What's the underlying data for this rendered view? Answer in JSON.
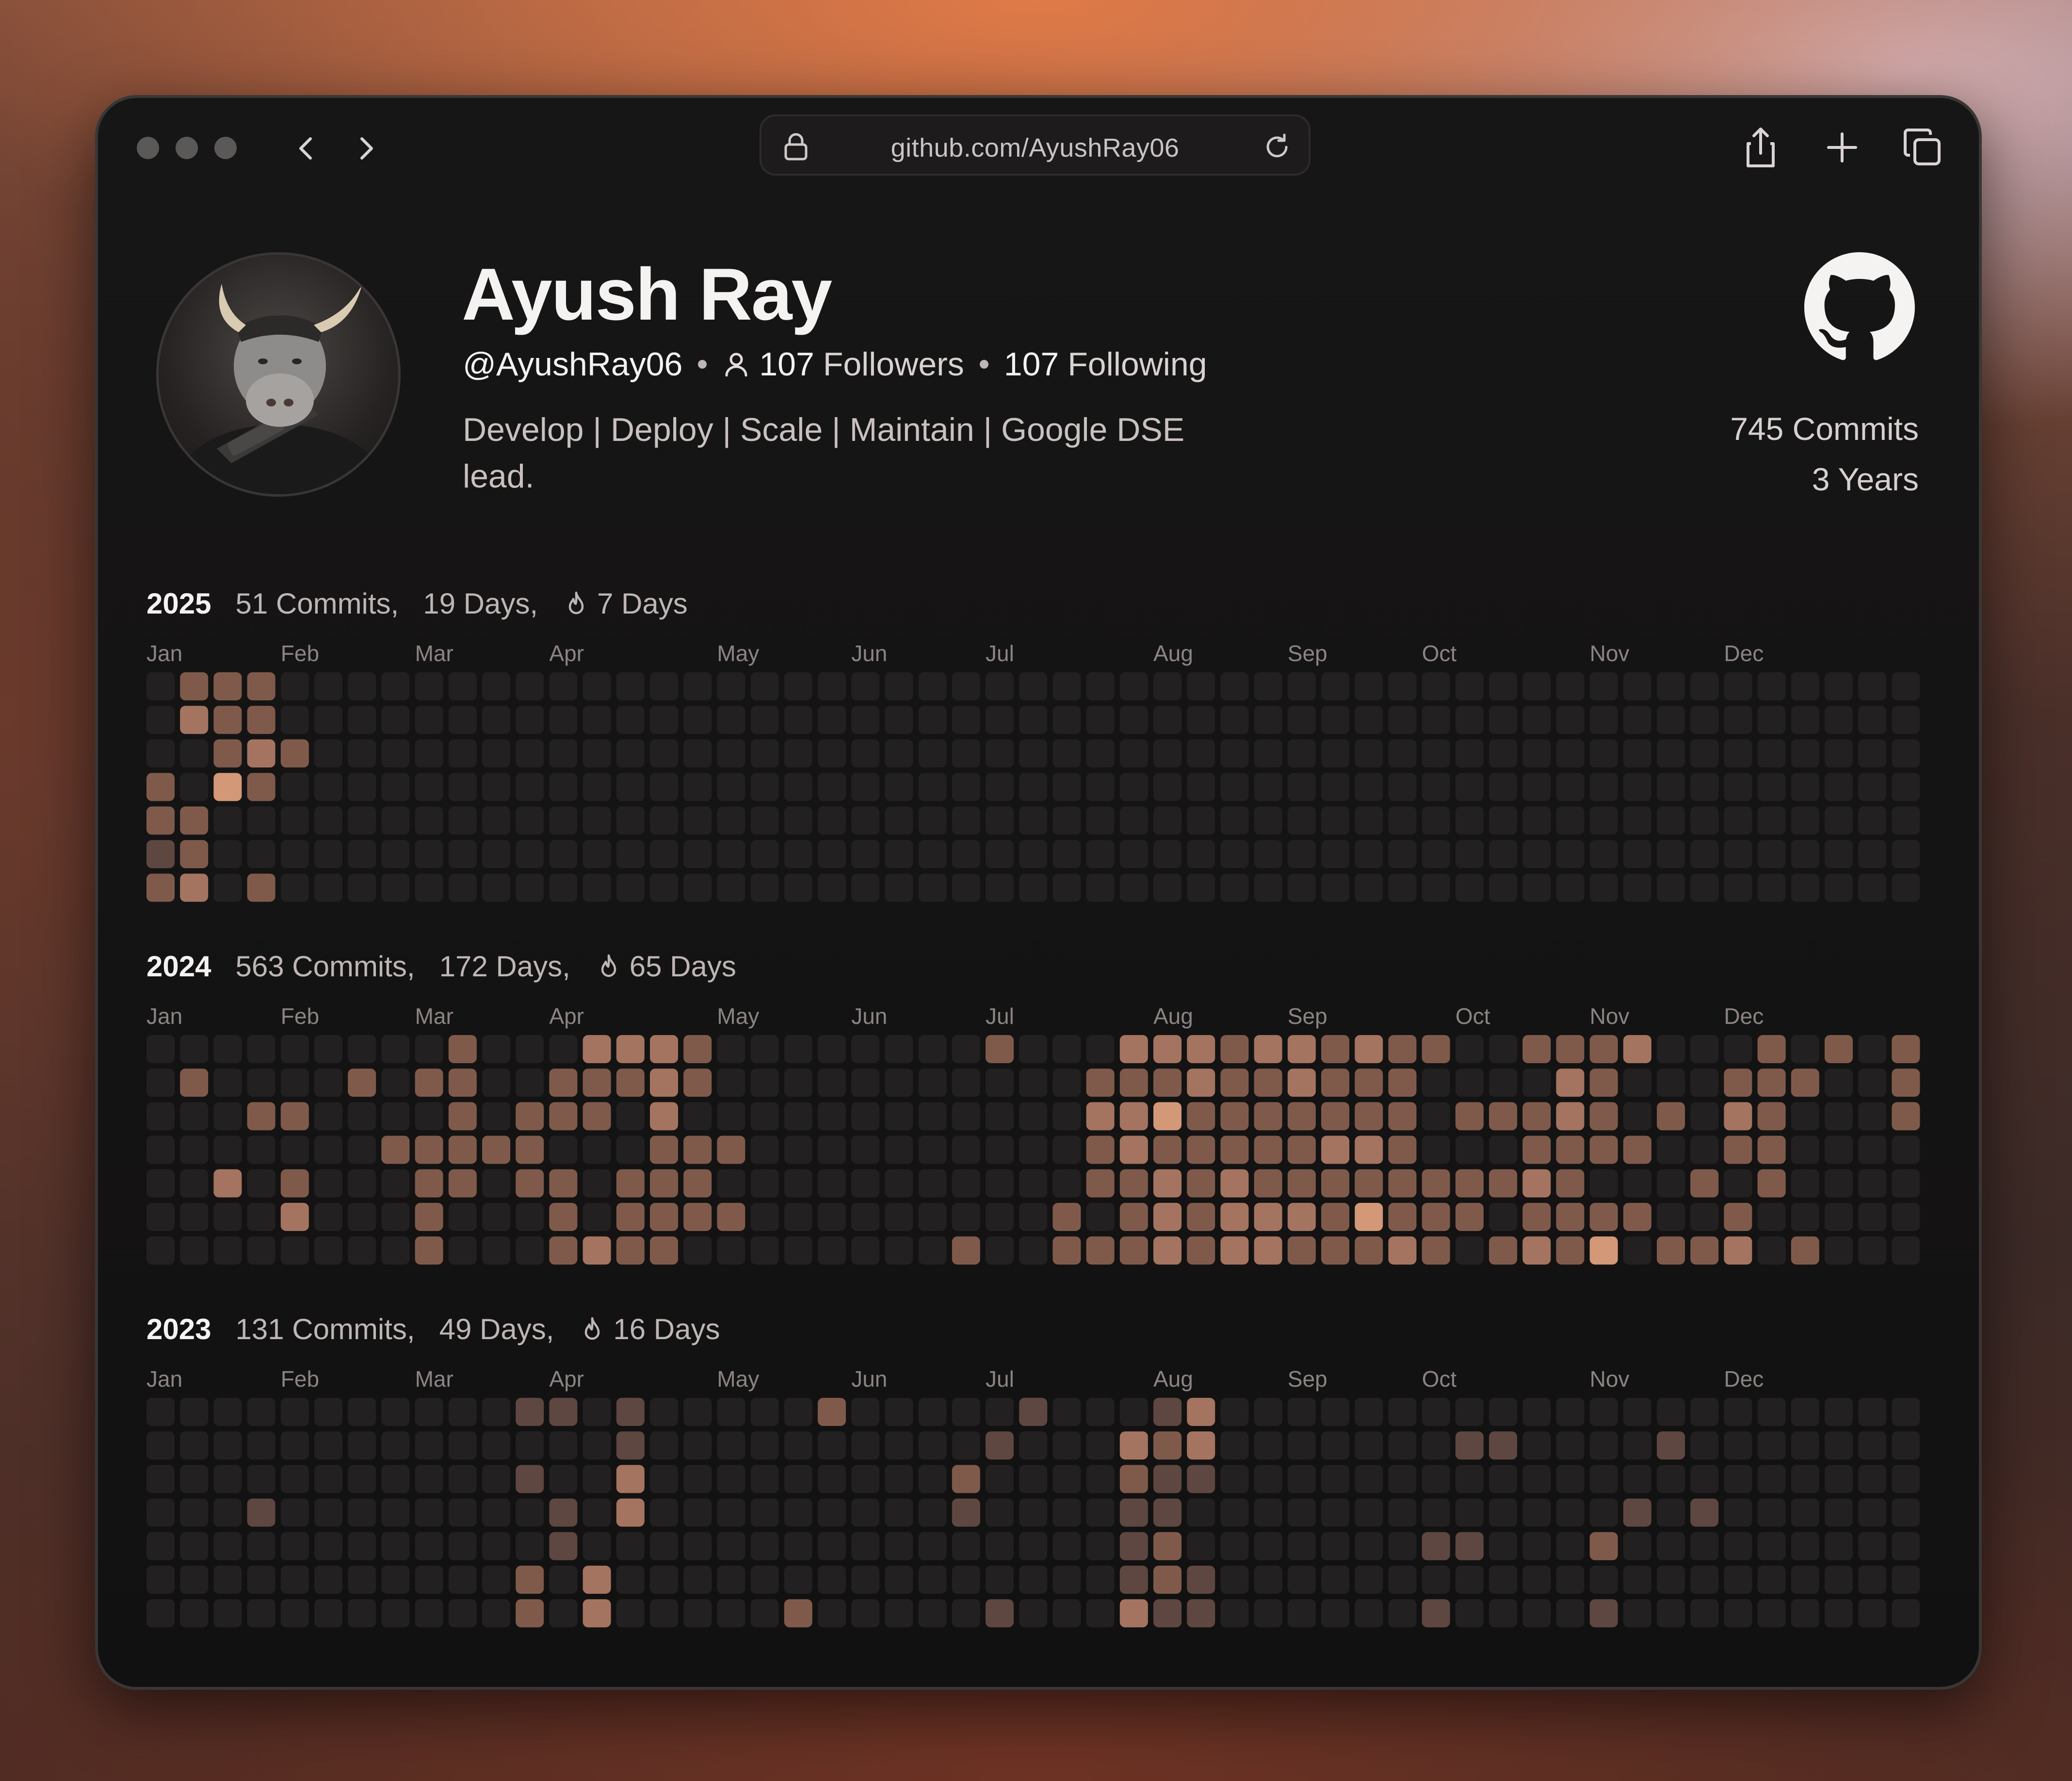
{
  "browser": {
    "url": "github.com/AyushRay06",
    "window_dots": [
      "close",
      "minimize",
      "zoom"
    ],
    "icons": [
      "chevron-left-icon",
      "chevron-right-icon",
      "lock-icon",
      "reload-icon",
      "share-icon",
      "plus-icon",
      "tabs-icon"
    ]
  },
  "profile": {
    "name": "Ayush Ray",
    "handle": "@AyushRay06",
    "followers_count": "107",
    "followers_label": "Followers",
    "following_count": "107",
    "following_label": "Following",
    "bio_line1": "Develop | Deploy | Scale | Maintain | Google DSE",
    "bio_line2": "lead.",
    "total_commits": "745 Commits",
    "total_years": "3 Years"
  },
  "colors": {
    "empty": "#222020",
    "level1": "#5e4740",
    "level2": "#7f5a4b",
    "level3": "#a47460",
    "level4": "#d39877"
  },
  "months": [
    "Jan",
    "Feb",
    "Mar",
    "Apr",
    "May",
    "Jun",
    "Jul",
    "Aug",
    "Sep",
    "Oct",
    "Nov",
    "Dec"
  ],
  "years": [
    {
      "year": "2025",
      "commits": "51 Commits,",
      "days": "19 Days,",
      "streak": "7 Days",
      "month_weeks": [
        0,
        4,
        8,
        12,
        17,
        21,
        25,
        30,
        34,
        38,
        43,
        47
      ],
      "active": [
        [
          1,
          0,
          2
        ],
        [
          2,
          0,
          2
        ],
        [
          3,
          0,
          2
        ],
        [
          1,
          1,
          3
        ],
        [
          2,
          1,
          2
        ],
        [
          3,
          1,
          2
        ],
        [
          2,
          2,
          2
        ],
        [
          3,
          2,
          3
        ],
        [
          4,
          2,
          2
        ],
        [
          0,
          3,
          2
        ],
        [
          2,
          3,
          4
        ],
        [
          3,
          3,
          2
        ],
        [
          0,
          4,
          2
        ],
        [
          1,
          4,
          2
        ],
        [
          0,
          5,
          1
        ],
        [
          1,
          5,
          2
        ],
        [
          0,
          6,
          2
        ],
        [
          1,
          6,
          3
        ],
        [
          3,
          6,
          2
        ]
      ]
    },
    {
      "year": "2024",
      "commits": "563 Commits,",
      "days": "172 Days,",
      "streak": "65 Days",
      "month_weeks": [
        0,
        4,
        8,
        12,
        17,
        21,
        25,
        30,
        34,
        39,
        43,
        47
      ],
      "active": [
        [
          9,
          0,
          2
        ],
        [
          13,
          0,
          3
        ],
        [
          14,
          0,
          3
        ],
        [
          15,
          0,
          3
        ],
        [
          16,
          0,
          2
        ],
        [
          25,
          0,
          2
        ],
        [
          29,
          0,
          3
        ],
        [
          30,
          0,
          3
        ],
        [
          31,
          0,
          3
        ],
        [
          32,
          0,
          2
        ],
        [
          33,
          0,
          3
        ],
        [
          34,
          0,
          3
        ],
        [
          35,
          0,
          2
        ],
        [
          36,
          0,
          3
        ],
        [
          37,
          0,
          2
        ],
        [
          38,
          0,
          2
        ],
        [
          41,
          0,
          2
        ],
        [
          42,
          0,
          2
        ],
        [
          43,
          0,
          2
        ],
        [
          44,
          0,
          3
        ],
        [
          48,
          0,
          2
        ],
        [
          50,
          0,
          2
        ],
        [
          52,
          0,
          2
        ],
        [
          1,
          1,
          2
        ],
        [
          6,
          1,
          2
        ],
        [
          8,
          1,
          2
        ],
        [
          9,
          1,
          2
        ],
        [
          12,
          1,
          2
        ],
        [
          13,
          1,
          2
        ],
        [
          14,
          1,
          2
        ],
        [
          15,
          1,
          3
        ],
        [
          16,
          1,
          2
        ],
        [
          28,
          1,
          2
        ],
        [
          29,
          1,
          2
        ],
        [
          30,
          1,
          2
        ],
        [
          31,
          1,
          3
        ],
        [
          32,
          1,
          2
        ],
        [
          33,
          1,
          2
        ],
        [
          34,
          1,
          3
        ],
        [
          35,
          1,
          2
        ],
        [
          36,
          1,
          2
        ],
        [
          37,
          1,
          2
        ],
        [
          42,
          1,
          3
        ],
        [
          43,
          1,
          2
        ],
        [
          47,
          1,
          2
        ],
        [
          48,
          1,
          2
        ],
        [
          49,
          1,
          2
        ],
        [
          52,
          1,
          2
        ],
        [
          3,
          2,
          2
        ],
        [
          4,
          2,
          2
        ],
        [
          9,
          2,
          2
        ],
        [
          11,
          2,
          2
        ],
        [
          12,
          2,
          2
        ],
        [
          13,
          2,
          2
        ],
        [
          15,
          2,
          3
        ],
        [
          28,
          2,
          3
        ],
        [
          29,
          2,
          3
        ],
        [
          30,
          2,
          4
        ],
        [
          31,
          2,
          2
        ],
        [
          32,
          2,
          2
        ],
        [
          33,
          2,
          2
        ],
        [
          34,
          2,
          2
        ],
        [
          35,
          2,
          2
        ],
        [
          36,
          2,
          2
        ],
        [
          37,
          2,
          2
        ],
        [
          39,
          2,
          2
        ],
        [
          40,
          2,
          2
        ],
        [
          41,
          2,
          2
        ],
        [
          42,
          2,
          3
        ],
        [
          43,
          2,
          2
        ],
        [
          45,
          2,
          2
        ],
        [
          47,
          2,
          3
        ],
        [
          48,
          2,
          2
        ],
        [
          52,
          2,
          2
        ],
        [
          7,
          3,
          2
        ],
        [
          8,
          3,
          2
        ],
        [
          9,
          3,
          2
        ],
        [
          10,
          3,
          2
        ],
        [
          11,
          3,
          2
        ],
        [
          15,
          3,
          2
        ],
        [
          16,
          3,
          2
        ],
        [
          17,
          3,
          2
        ],
        [
          28,
          3,
          2
        ],
        [
          29,
          3,
          3
        ],
        [
          30,
          3,
          2
        ],
        [
          31,
          3,
          2
        ],
        [
          32,
          3,
          2
        ],
        [
          33,
          3,
          2
        ],
        [
          34,
          3,
          2
        ],
        [
          35,
          3,
          3
        ],
        [
          36,
          3,
          3
        ],
        [
          37,
          3,
          2
        ],
        [
          41,
          3,
          2
        ],
        [
          42,
          3,
          2
        ],
        [
          43,
          3,
          2
        ],
        [
          44,
          3,
          2
        ],
        [
          47,
          3,
          2
        ],
        [
          48,
          3,
          2
        ],
        [
          2,
          4,
          3
        ],
        [
          4,
          4,
          2
        ],
        [
          8,
          4,
          2
        ],
        [
          9,
          4,
          2
        ],
        [
          11,
          4,
          2
        ],
        [
          12,
          4,
          2
        ],
        [
          14,
          4,
          2
        ],
        [
          15,
          4,
          2
        ],
        [
          16,
          4,
          2
        ],
        [
          28,
          4,
          2
        ],
        [
          29,
          4,
          2
        ],
        [
          30,
          4,
          3
        ],
        [
          31,
          4,
          2
        ],
        [
          32,
          4,
          3
        ],
        [
          33,
          4,
          2
        ],
        [
          34,
          4,
          2
        ],
        [
          35,
          4,
          2
        ],
        [
          36,
          4,
          2
        ],
        [
          37,
          4,
          2
        ],
        [
          38,
          4,
          2
        ],
        [
          39,
          4,
          2
        ],
        [
          40,
          4,
          2
        ],
        [
          41,
          4,
          3
        ],
        [
          42,
          4,
          2
        ],
        [
          46,
          4,
          2
        ],
        [
          48,
          4,
          2
        ],
        [
          4,
          5,
          3
        ],
        [
          8,
          5,
          2
        ],
        [
          12,
          5,
          2
        ],
        [
          14,
          5,
          2
        ],
        [
          15,
          5,
          2
        ],
        [
          16,
          5,
          2
        ],
        [
          17,
          5,
          2
        ],
        [
          27,
          5,
          2
        ],
        [
          29,
          5,
          2
        ],
        [
          30,
          5,
          3
        ],
        [
          31,
          5,
          2
        ],
        [
          32,
          5,
          3
        ],
        [
          33,
          5,
          3
        ],
        [
          34,
          5,
          3
        ],
        [
          35,
          5,
          2
        ],
        [
          36,
          5,
          4
        ],
        [
          37,
          5,
          2
        ],
        [
          38,
          5,
          2
        ],
        [
          39,
          5,
          2
        ],
        [
          41,
          5,
          2
        ],
        [
          42,
          5,
          2
        ],
        [
          43,
          5,
          2
        ],
        [
          44,
          5,
          2
        ],
        [
          47,
          5,
          2
        ],
        [
          8,
          6,
          2
        ],
        [
          12,
          6,
          2
        ],
        [
          13,
          6,
          3
        ],
        [
          14,
          6,
          2
        ],
        [
          15,
          6,
          2
        ],
        [
          24,
          6,
          2
        ],
        [
          27,
          6,
          2
        ],
        [
          28,
          6,
          2
        ],
        [
          29,
          6,
          2
        ],
        [
          30,
          6,
          3
        ],
        [
          31,
          6,
          2
        ],
        [
          32,
          6,
          3
        ],
        [
          33,
          6,
          3
        ],
        [
          34,
          6,
          2
        ],
        [
          35,
          6,
          2
        ],
        [
          36,
          6,
          2
        ],
        [
          37,
          6,
          3
        ],
        [
          38,
          6,
          2
        ],
        [
          40,
          6,
          2
        ],
        [
          41,
          6,
          3
        ],
        [
          42,
          6,
          2
        ],
        [
          43,
          6,
          4
        ],
        [
          45,
          6,
          2
        ],
        [
          46,
          6,
          2
        ],
        [
          47,
          6,
          3
        ],
        [
          49,
          6,
          2
        ]
      ]
    },
    {
      "year": "2023",
      "commits": "131 Commits,",
      "days": "49 Days,",
      "streak": "16 Days",
      "month_weeks": [
        0,
        4,
        8,
        12,
        17,
        21,
        25,
        30,
        34,
        38,
        43,
        47
      ],
      "active": [
        [
          11,
          0,
          1
        ],
        [
          12,
          0,
          1
        ],
        [
          14,
          0,
          1
        ],
        [
          20,
          0,
          2
        ],
        [
          26,
          0,
          1
        ],
        [
          30,
          0,
          1
        ],
        [
          31,
          0,
          3
        ],
        [
          14,
          1,
          1
        ],
        [
          25,
          1,
          1
        ],
        [
          29,
          1,
          3
        ],
        [
          30,
          1,
          2
        ],
        [
          31,
          1,
          3
        ],
        [
          39,
          1,
          1
        ],
        [
          40,
          1,
          1
        ],
        [
          45,
          1,
          1
        ],
        [
          11,
          2,
          1
        ],
        [
          14,
          2,
          3
        ],
        [
          24,
          2,
          2
        ],
        [
          29,
          2,
          2
        ],
        [
          30,
          2,
          1
        ],
        [
          31,
          2,
          1
        ],
        [
          3,
          3,
          1
        ],
        [
          12,
          3,
          1
        ],
        [
          14,
          3,
          3
        ],
        [
          24,
          3,
          1
        ],
        [
          29,
          3,
          1
        ],
        [
          30,
          3,
          1
        ],
        [
          44,
          3,
          1
        ],
        [
          46,
          3,
          1
        ],
        [
          12,
          4,
          1
        ],
        [
          29,
          4,
          1
        ],
        [
          30,
          4,
          2
        ],
        [
          38,
          4,
          1
        ],
        [
          39,
          4,
          1
        ],
        [
          43,
          4,
          2
        ],
        [
          11,
          5,
          2
        ],
        [
          13,
          5,
          3
        ],
        [
          29,
          5,
          1
        ],
        [
          30,
          5,
          2
        ],
        [
          31,
          5,
          1
        ],
        [
          11,
          6,
          2
        ],
        [
          13,
          6,
          3
        ],
        [
          19,
          6,
          2
        ],
        [
          25,
          6,
          1
        ],
        [
          29,
          6,
          3
        ],
        [
          30,
          6,
          1
        ],
        [
          31,
          6,
          1
        ],
        [
          38,
          6,
          1
        ],
        [
          43,
          6,
          1
        ]
      ]
    }
  ]
}
